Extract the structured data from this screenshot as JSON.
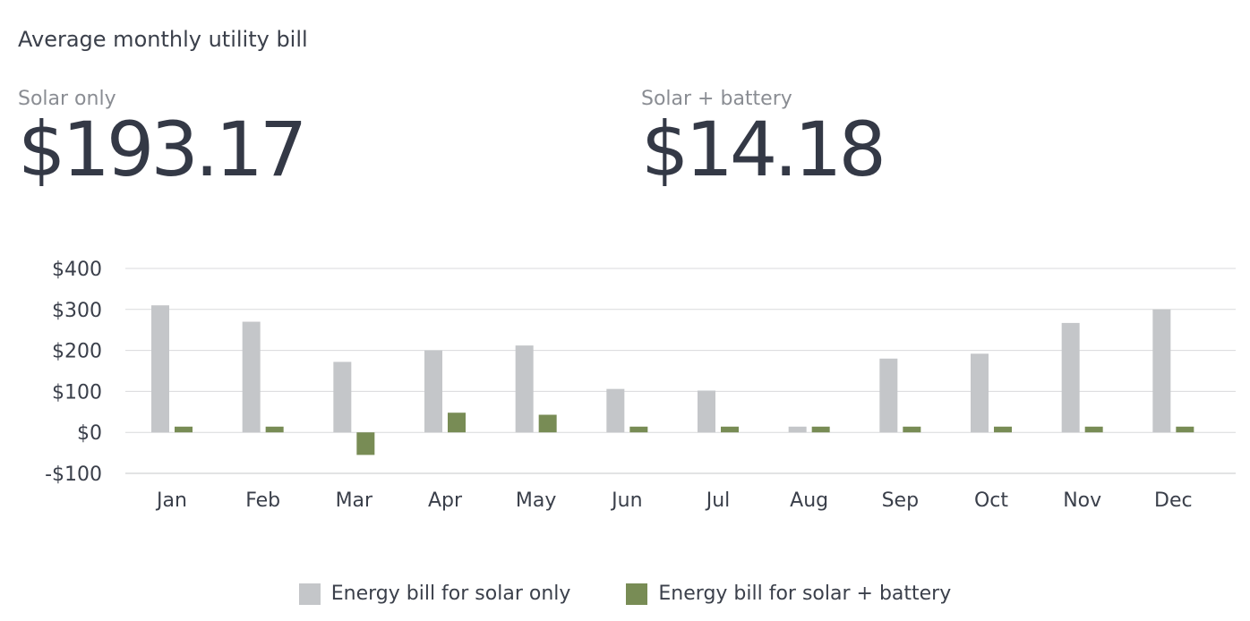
{
  "title": "Average monthly utility bill",
  "stats": [
    {
      "label": "Solar only",
      "value": "$193.17"
    },
    {
      "label": "Solar + battery",
      "value": "$14.18"
    }
  ],
  "colors": {
    "solar_only": "#c4c6c9",
    "solar_battery": "#788c55",
    "grid": "#d9dadc",
    "text": "#3a3f4a"
  },
  "chart_data": {
    "type": "bar",
    "categories": [
      "Jan",
      "Feb",
      "Mar",
      "Apr",
      "May",
      "Jun",
      "Jul",
      "Aug",
      "Sep",
      "Oct",
      "Nov",
      "Dec"
    ],
    "series": [
      {
        "name": "Energy bill for solar only",
        "values": [
          310,
          270,
          172,
          200,
          212,
          106,
          102,
          14,
          180,
          192,
          267,
          300
        ]
      },
      {
        "name": "Energy bill for solar + battery",
        "values": [
          14,
          14,
          -55,
          48,
          43,
          14,
          14,
          14,
          14,
          14,
          14,
          14
        ]
      }
    ],
    "yticks": [
      "$400",
      "$300",
      "$200",
      "$100",
      "$0",
      "-$100"
    ],
    "ylim": [
      -100,
      400
    ],
    "grid": true,
    "legend": "bottom-center"
  }
}
